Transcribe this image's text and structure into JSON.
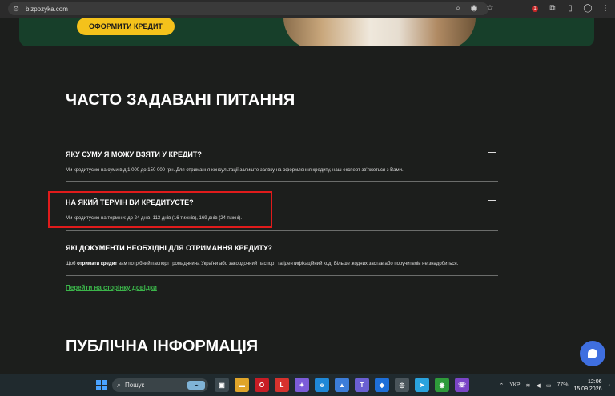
{
  "browser": {
    "url": "bizpozyka.com",
    "battery_badge": "1"
  },
  "hero": {
    "cta_label": "ОФОРМИТИ КРЕДИТ"
  },
  "faq": {
    "title": "ЧАСТО ЗАДАВАНІ ПИТАННЯ",
    "items": [
      {
        "question": "ЯКУ СУМУ Я МОЖУ ВЗЯТИ У КРЕДИТ?",
        "answer": "Ми кредитуємо на суми від 1 000 до 150 000 грн. Для отримання консультації залиште заявку на оформлення кредиту, наш експерт зв'яжеться з Вами."
      },
      {
        "question": "НА ЯКИЙ ТЕРМІН ВИ КРЕДИТУЄТЕ?",
        "answer": "Ми кредитуємо на терміни: до 24 днів, 113 днів (16 тижнів), 169 днів (24 тижні)."
      },
      {
        "question": "ЯКІ ДОКУМЕНТИ НЕОБХІДНІ ДЛЯ ОТРИМАННЯ КРЕДИТУ?",
        "answer_prefix": "Щоб ",
        "answer_bold": "отримати кредит",
        "answer_suffix": " вам потрібний паспорт громадянина України або закордонний паспорт та ідентифікаційний код. Більше жодних застав або поручителів не знадобиться."
      }
    ],
    "help_link": "Перейти на сторінку довідки"
  },
  "public": {
    "title": "ПУБЛІЧНА ІНФОРМАЦІЯ"
  },
  "taskbar": {
    "search_label": "Пошук",
    "language": "УКР",
    "battery": "77%",
    "time": "12:06",
    "date": "15.09.2026"
  },
  "colors": {
    "page_bg": "#1c1e1c",
    "accent_yellow": "#f4c21b",
    "link_green": "#3bb54a",
    "highlight_red": "#e01b1b",
    "chat_blue": "#3f6fe0"
  }
}
